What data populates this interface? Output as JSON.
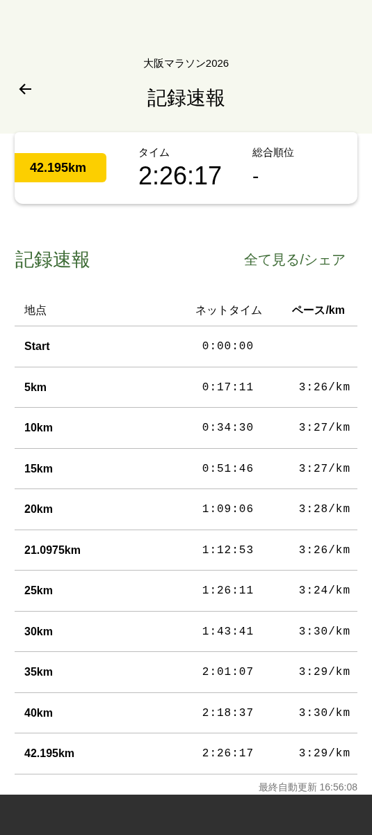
{
  "header": {
    "event_title": "大阪マラソン2026",
    "page_title": "記録速報"
  },
  "summary": {
    "distance_badge": "42.195km",
    "time_label": "タイム",
    "time_value": "2:26:17",
    "rank_label": "総合順位",
    "rank_value": "-"
  },
  "section": {
    "title": "記録速報",
    "link": "全て見る/シェア"
  },
  "table": {
    "columns": [
      "地点",
      "ネットタイム",
      "ペース/km"
    ],
    "rows": [
      {
        "point": "Start",
        "net_time": "0:00:00"
      },
      {
        "point": "5km",
        "net_time": "0:17:11",
        "pace": "3:26/km"
      },
      {
        "point": "10km",
        "net_time": "0:34:30",
        "pace": "3:27/km"
      },
      {
        "point": "15km",
        "net_time": "0:51:46",
        "pace": "3:27/km"
      },
      {
        "point": "20km",
        "net_time": "1:09:06",
        "pace": "3:28/km"
      },
      {
        "point": "21.0975km",
        "net_time": "1:12:53",
        "pace": "3:26/km"
      },
      {
        "point": "25km",
        "net_time": "1:26:11",
        "pace": "3:24/km"
      },
      {
        "point": "30km",
        "net_time": "1:43:41",
        "pace": "3:30/km"
      },
      {
        "point": "35km",
        "net_time": "2:01:07",
        "pace": "3:29/km"
      },
      {
        "point": "40km",
        "net_time": "2:18:37",
        "pace": "3:30/km"
      },
      {
        "point": "42.195km",
        "net_time": "2:26:17",
        "pace": "3:29/km"
      }
    ]
  },
  "footer": {
    "last_updated": "最終自動更新 16:56:08"
  }
}
